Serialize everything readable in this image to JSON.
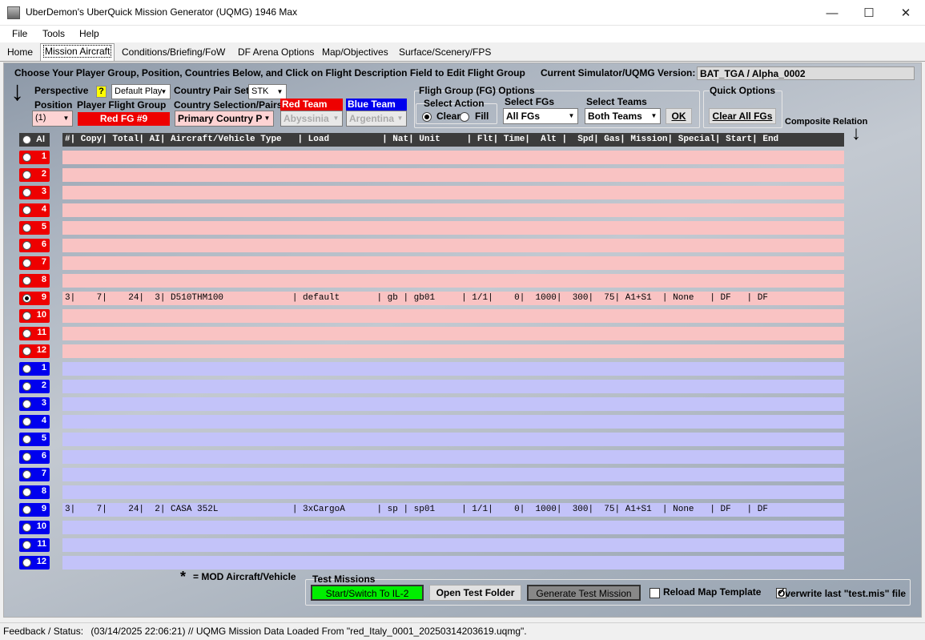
{
  "window": {
    "title": "UberDemon's UberQuick Mission Generator (UQMG) 1946 Max",
    "minimize": "—",
    "maximize": "☐",
    "close": "✕"
  },
  "menu": {
    "file": "File",
    "tools": "Tools",
    "help": "Help"
  },
  "tabs": [
    "Home",
    "Mission Aircraft",
    "Conditions/Briefing/FoW",
    "DF Arena Options",
    "Map/Objectives",
    "Surface/Scenery/FPS"
  ],
  "instructions": "Choose Your Player Group, Position, Countries Below, and Click on Flight Description Field to Edit Flight Group",
  "version": {
    "label": "Current Simulator/UQMG Version:",
    "value": "BAT_TGA / Alpha_0002"
  },
  "perspective": {
    "label": "Perspective",
    "help": "?",
    "value": "Default Play"
  },
  "position": {
    "label": "Position",
    "value": "(1)"
  },
  "player_flight_group": {
    "label": "Player Flight Group",
    "value": "Red FG #9"
  },
  "country_pair_set": {
    "label": "Country Pair Set",
    "value": "STK"
  },
  "country_selection": {
    "label": "Country Selection/Pairs",
    "value": "Primary Country P"
  },
  "red_team": {
    "label": "Red Team",
    "value": "Abyssinia"
  },
  "blue_team": {
    "label": "Blue Team",
    "value": "Argentina"
  },
  "fg_options": {
    "title": "Fligh Group (FG) Options",
    "select_action": "Select Action",
    "clear": "Clear",
    "fill": "Fill",
    "select_fgs_label": "Select FGs",
    "select_fgs_value": "All FGs",
    "select_teams_label": "Select Teams",
    "select_teams_value": "Both Teams",
    "ok": "OK"
  },
  "quick_options": {
    "title": "Quick Options",
    "clear_all": "Clear All FGs"
  },
  "composite_relation": "Composite Relation",
  "arrow": "↓",
  "table_header": {
    "all": "Al",
    "columns": "#| Copy| Total| AI| Aircraft/Vehicle Type   | Load          | Nat| Unit     | Flt| Time|  Alt |  Spd| Gas| Mission| Special| Start| End"
  },
  "red_rows": [
    {
      "num": "1",
      "text": ""
    },
    {
      "num": "2",
      "text": ""
    },
    {
      "num": "3",
      "text": ""
    },
    {
      "num": "4",
      "text": ""
    },
    {
      "num": "5",
      "text": ""
    },
    {
      "num": "6",
      "text": ""
    },
    {
      "num": "7",
      "text": ""
    },
    {
      "num": "8",
      "text": ""
    },
    {
      "num": "9",
      "text": "3|    7|    24|  3| D510THM100             | default       | gb | gb01     | 1/1|    0|  1000|  300|  75| A1+S1  | None   | DF   | DF"
    },
    {
      "num": "10",
      "text": ""
    },
    {
      "num": "11",
      "text": ""
    },
    {
      "num": "12",
      "text": ""
    }
  ],
  "blue_rows": [
    {
      "num": "1",
      "text": ""
    },
    {
      "num": "2",
      "text": ""
    },
    {
      "num": "3",
      "text": ""
    },
    {
      "num": "4",
      "text": ""
    },
    {
      "num": "5",
      "text": ""
    },
    {
      "num": "6",
      "text": ""
    },
    {
      "num": "7",
      "text": ""
    },
    {
      "num": "8",
      "text": ""
    },
    {
      "num": "9",
      "text": "3|    7|    24|  2| CASA 352L              | 3xCargoA      | sp | sp01     | 1/1|    0|  1000|  300|  75| A1+S1  | None   | DF   | DF"
    },
    {
      "num": "10",
      "text": ""
    },
    {
      "num": "11",
      "text": ""
    },
    {
      "num": "12",
      "text": ""
    }
  ],
  "mod_note": {
    "star": "*",
    "text": "= MOD Aircraft/Vehicle"
  },
  "test_missions": {
    "title": "Test Missions",
    "start_switch": "Start/Switch To IL-2",
    "open_folder": "Open Test Folder",
    "generate": "Generate Test Mission",
    "reload_map": "Reload Map Template",
    "overwrite": "Overwrite last \"test.mis\" file",
    "reload_checked": "false",
    "overwrite_checked": "true"
  },
  "status": {
    "label": "Feedback / Status:",
    "text": "(03/14/2025 22:06:21) // UQMG Mission Data Loaded From \"red_Italy_0001_20250314203619.uqmg\"."
  },
  "colors": {
    "red": "#ee0000",
    "blue": "#0000ee",
    "green_button": "#00ee00",
    "red_row": "#f9c3c3",
    "blue_row": "#c3c3f9"
  }
}
